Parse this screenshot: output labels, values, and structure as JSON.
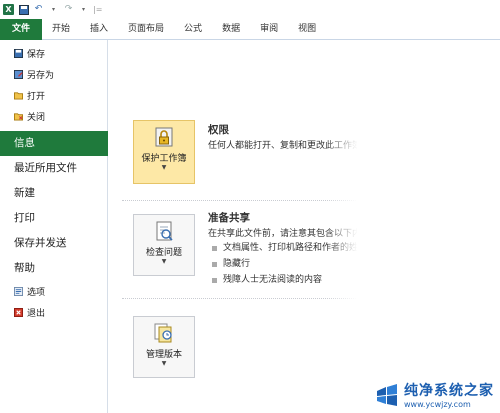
{
  "qat": {
    "logo": "X",
    "sep": "|="
  },
  "tabs": [
    {
      "label": "文件"
    },
    {
      "label": "开始"
    },
    {
      "label": "插入"
    },
    {
      "label": "页面布局"
    },
    {
      "label": "公式"
    },
    {
      "label": "数据"
    },
    {
      "label": "审阅"
    },
    {
      "label": "视图"
    }
  ],
  "nav": {
    "save": "保存",
    "save_as": "另存为",
    "open": "打开",
    "close": "关闭",
    "info": "信息",
    "recent": "最近所用文件",
    "new": "新建",
    "print": "打印",
    "save_send": "保存并发送",
    "help": "帮助",
    "options": "选项",
    "exit": "退出"
  },
  "permissions": {
    "button": "保护工作簿",
    "title": "权限",
    "desc": "任何人都能打开、复制和更改此工作簿的任何部分。"
  },
  "prepare": {
    "button": "检查问题",
    "title": "准备共享",
    "desc": "在共享此文件前，请注意其包含以下内容:",
    "items": [
      "文档属性、打印机路径和作者的姓名",
      "隐藏行",
      "残障人士无法阅读的内容"
    ]
  },
  "versions": {
    "button": "管理版本"
  },
  "watermark": {
    "cn": "纯净系统之家",
    "url": "www.ycwjzy.com"
  },
  "colors": {
    "accent": "#1f7a3c",
    "highlight": "#fde8a6"
  }
}
